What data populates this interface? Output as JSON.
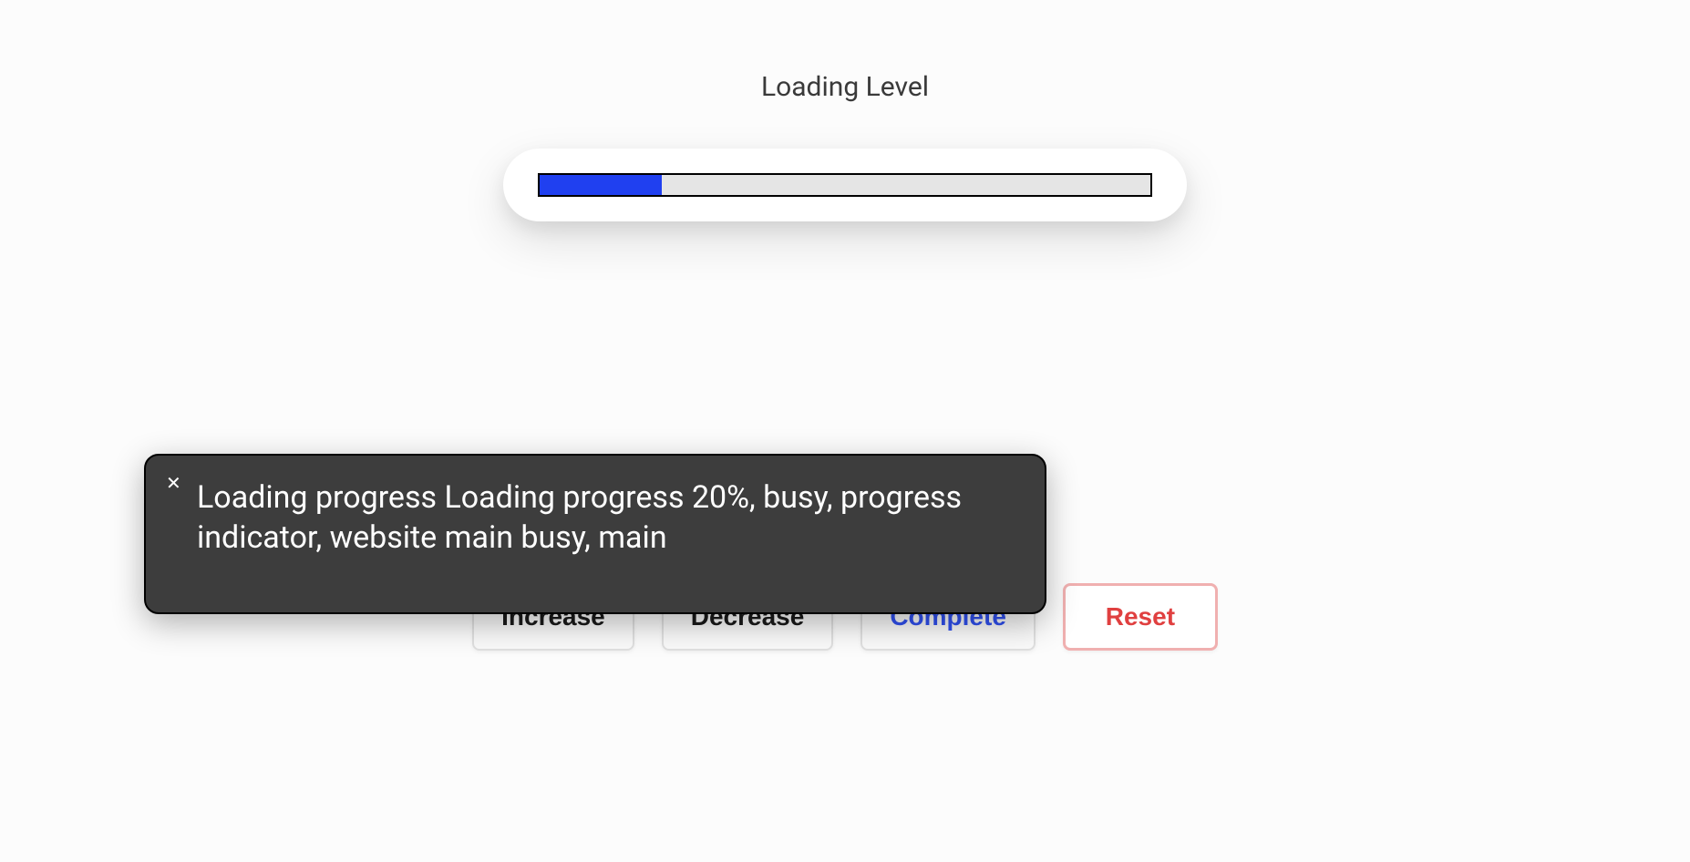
{
  "header": {
    "title": "Loading Level"
  },
  "progress": {
    "percent": 20
  },
  "buttons": {
    "increase": "Increase",
    "decrease": "Decrease",
    "complete": "Complete",
    "reset": "Reset"
  },
  "tooltip": {
    "text": "Loading progress Loading progress 20%, busy, progress indicator, website main busy, main"
  }
}
